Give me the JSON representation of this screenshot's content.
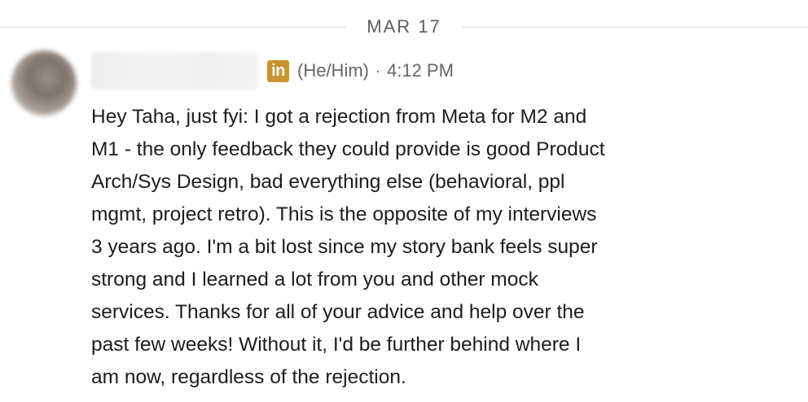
{
  "date_divider": {
    "label": "MAR 17"
  },
  "message": {
    "pronouns": "(He/Him)",
    "separator": "·",
    "time": "4:12 PM",
    "body_lines": [
      "Hey Taha, just fyi: I got a rejection from Meta for M2 and",
      "M1 - the only feedback they could provide is good Product",
      "Arch/Sys Design, bad everything else (behavioral, ppl",
      "mgmt, project retro). This is the opposite of my interviews",
      "3 years ago. I'm a bit lost since my story bank feels super",
      "strong and I learned a lot from you and other mock",
      "services. Thanks for all of your advice and help over the",
      "past few weeks! Without it, I'd be further behind where I",
      "am now, regardless of the rejection."
    ]
  },
  "icons": {
    "linkedin_badge": "in",
    "linkedin_badge_color": "#c9932f"
  }
}
